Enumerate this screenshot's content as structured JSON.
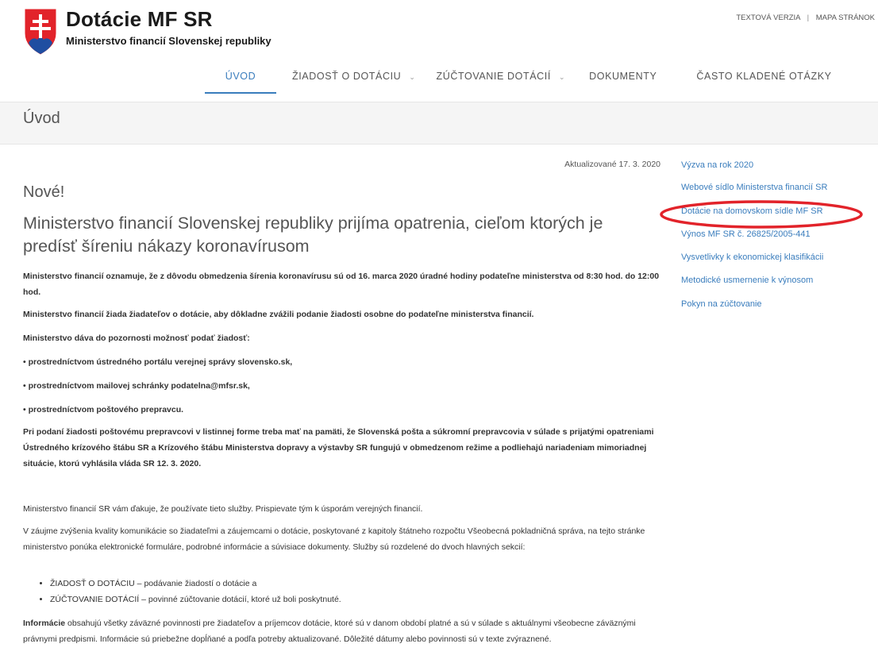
{
  "header": {
    "site_title": "Dotácie MF SR",
    "site_subtitle": "Ministerstvo financií Slovenskej republiky",
    "top_links": [
      "TEXTOVÁ VERZIA",
      "MAPA STRÁNOK"
    ],
    "top_links_separator": "|",
    "brand_colors": {
      "shield_red": "#e2232a",
      "shield_blue": "#1f4ea1",
      "accent": "#3a7dbd"
    }
  },
  "nav": {
    "items": [
      {
        "label": "ÚVOD",
        "active": true,
        "has_dropdown": false
      },
      {
        "label": "ŽIADOSŤ O DOTÁCIU",
        "active": false,
        "has_dropdown": true
      },
      {
        "label": "ZÚČTOVANIE DOTÁCIÍ",
        "active": false,
        "has_dropdown": true
      },
      {
        "label": "DOKUMENTY",
        "active": false,
        "has_dropdown": false
      },
      {
        "label": "ČASTO KLADENÉ OTÁZKY",
        "active": false,
        "has_dropdown": false
      }
    ],
    "dropdown_glyph": "⌄"
  },
  "page": {
    "title": "Úvod"
  },
  "main": {
    "updated": "Aktualizované 17. 3. 2020",
    "nove": "Nové!",
    "headline": "Ministerstvo financií Slovenskej republiky prijíma opatrenia, cieľom ktorých je predísť šíreniu nákazy koronavírusom",
    "p1": "Ministerstvo financií oznamuje, že z dôvodu obmedzenia šírenia koronavírusu sú od 16. marca 2020 úradné hodiny podateľne ministerstva od 8:30 hod. do 12:00 hod.",
    "p2": "Ministerstvo financií žiada žiadateľov o dotácie, aby dôkladne zvážili podanie žiadosti osobne do podateľne ministerstva financií.",
    "p3": "Ministerstvo dáva do pozornosti možnosť podať žiadosť:",
    "b1": "• prostredníctvom ústredného portálu verejnej správy slovensko.sk,",
    "b2": "• prostredníctvom mailovej schránky podatelna@mfsr.sk,",
    "b3": "• prostredníctvom poštového prepravcu.",
    "p4": "Pri podaní žiadosti poštovému prepravcovi v listinnej forme treba mať na pamäti, že Slovenská pošta a súkromní prepravcovia v súlade s prijatými opatreniami Ústredného krízového štábu SR a Krízového štábu Ministerstva dopravy a výstavby SR fungujú v obmedzenom režime a podliehajú nariadeniam mimoriadnej situácie, ktorú vyhlásila vláda SR 12. 3. 2020.",
    "p5": "Ministerstvo financií SR vám ďakuje, že používate tieto služby. Prispievate tým k úsporám verejných financií.",
    "p6": "V záujme zvýšenia kvality komunikácie so žiadateľmi a záujemcami o dotácie, poskytované z kapitoly štátneho rozpočtu Všeobecná pokladničná správa, na tejto stránke ministerstvo ponúka elektronické formuláre, podrobné informácie a súvisiace dokumenty. Služby sú rozdelené do dvoch hlavných sekcií:",
    "list": [
      {
        "strong": "ŽIADOSŤ O DOTÁCIU",
        "rest": " – podávanie žiadostí o dotácie a"
      },
      {
        "strong": "ZÚČTOVANIE DOTÁCIÍ",
        "rest": " – povinné zúčtovanie dotácií, ktoré už boli poskytnuté."
      }
    ],
    "p7_strong": "Informácie",
    "p7_rest": " obsahujú všetky záväzné povinnosti pre žiadateľov a príjemcov dotácie, ktoré sú v danom období platné a sú v súlade s aktuálnymi všeobecne záväznými právnymi predpismi. Informácie sú priebežne dopĺňané a podľa potreby aktualizované. Dôležité dátumy alebo povinnosti sú v texte zvýraznené."
  },
  "sidebar": {
    "links": [
      "Výzva na rok 2020",
      "Webové sídlo Ministerstva financií SR",
      "Dotácie na domovskom sídle MF SR",
      "Výnos MF SR č. 26825/2005-441",
      "Vysvetlivky k ekonomickej klasifikácii",
      "Metodické usmernenie k výnosom",
      "Pokyn na zúčtovanie"
    ],
    "highlighted_index": 2,
    "highlight_color": "#e2232a"
  }
}
